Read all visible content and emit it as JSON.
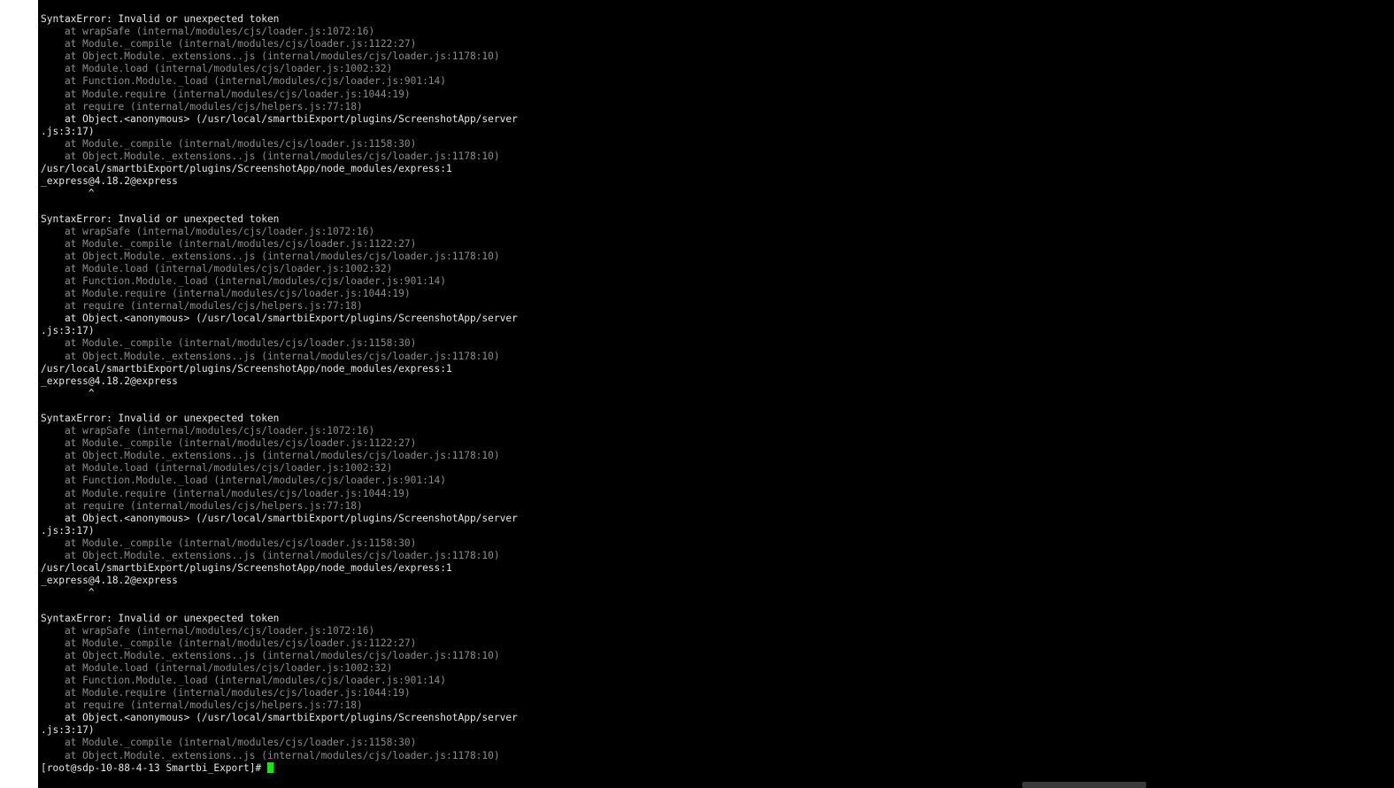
{
  "terminal": {
    "cursor_color": "#19e619",
    "lines": [
      {
        "t": "SyntaxError: Invalid or unexpected token",
        "c": "hl"
      },
      {
        "t": "    at wrapSafe (internal/modules/cjs/loader.js:1072:16)",
        "c": "dim"
      },
      {
        "t": "    at Module._compile (internal/modules/cjs/loader.js:1122:27)",
        "c": "dim"
      },
      {
        "t": "    at Object.Module._extensions..js (internal/modules/cjs/loader.js:1178:10)",
        "c": "dim"
      },
      {
        "t": "    at Module.load (internal/modules/cjs/loader.js:1002:32)",
        "c": "dim"
      },
      {
        "t": "    at Function.Module._load (internal/modules/cjs/loader.js:901:14)",
        "c": "dim"
      },
      {
        "t": "    at Module.require (internal/modules/cjs/loader.js:1044:19)",
        "c": "dim"
      },
      {
        "t": "    at require (internal/modules/cjs/helpers.js:77:18)",
        "c": "dim"
      },
      {
        "t": "    at Object.<anonymous> (/usr/local/smartbiExport/plugins/ScreenshotApp/server",
        "c": "hl"
      },
      {
        "t": ".js:3:17)",
        "c": "hl"
      },
      {
        "t": "    at Module._compile (internal/modules/cjs/loader.js:1158:30)",
        "c": "dim"
      },
      {
        "t": "    at Object.Module._extensions..js (internal/modules/cjs/loader.js:1178:10)",
        "c": "dim"
      },
      {
        "t": "/usr/local/smartbiExport/plugins/ScreenshotApp/node_modules/express:1",
        "c": "hl"
      },
      {
        "t": "_express@4.18.2@express",
        "c": "hl"
      },
      {
        "t": "        ^",
        "c": "hl"
      },
      {
        "t": "",
        "c": "hl"
      },
      {
        "t": "SyntaxError: Invalid or unexpected token",
        "c": "hl"
      },
      {
        "t": "    at wrapSafe (internal/modules/cjs/loader.js:1072:16)",
        "c": "dim"
      },
      {
        "t": "    at Module._compile (internal/modules/cjs/loader.js:1122:27)",
        "c": "dim"
      },
      {
        "t": "    at Object.Module._extensions..js (internal/modules/cjs/loader.js:1178:10)",
        "c": "dim"
      },
      {
        "t": "    at Module.load (internal/modules/cjs/loader.js:1002:32)",
        "c": "dim"
      },
      {
        "t": "    at Function.Module._load (internal/modules/cjs/loader.js:901:14)",
        "c": "dim"
      },
      {
        "t": "    at Module.require (internal/modules/cjs/loader.js:1044:19)",
        "c": "dim"
      },
      {
        "t": "    at require (internal/modules/cjs/helpers.js:77:18)",
        "c": "dim"
      },
      {
        "t": "    at Object.<anonymous> (/usr/local/smartbiExport/plugins/ScreenshotApp/server",
        "c": "hl"
      },
      {
        "t": ".js:3:17)",
        "c": "hl"
      },
      {
        "t": "    at Module._compile (internal/modules/cjs/loader.js:1158:30)",
        "c": "dim"
      },
      {
        "t": "    at Object.Module._extensions..js (internal/modules/cjs/loader.js:1178:10)",
        "c": "dim"
      },
      {
        "t": "/usr/local/smartbiExport/plugins/ScreenshotApp/node_modules/express:1",
        "c": "hl"
      },
      {
        "t": "_express@4.18.2@express",
        "c": "hl"
      },
      {
        "t": "        ^",
        "c": "hl"
      },
      {
        "t": "",
        "c": "hl"
      },
      {
        "t": "SyntaxError: Invalid or unexpected token",
        "c": "hl"
      },
      {
        "t": "    at wrapSafe (internal/modules/cjs/loader.js:1072:16)",
        "c": "dim"
      },
      {
        "t": "    at Module._compile (internal/modules/cjs/loader.js:1122:27)",
        "c": "dim"
      },
      {
        "t": "    at Object.Module._extensions..js (internal/modules/cjs/loader.js:1178:10)",
        "c": "dim"
      },
      {
        "t": "    at Module.load (internal/modules/cjs/loader.js:1002:32)",
        "c": "dim"
      },
      {
        "t": "    at Function.Module._load (internal/modules/cjs/loader.js:901:14)",
        "c": "dim"
      },
      {
        "t": "    at Module.require (internal/modules/cjs/loader.js:1044:19)",
        "c": "dim"
      },
      {
        "t": "    at require (internal/modules/cjs/helpers.js:77:18)",
        "c": "dim"
      },
      {
        "t": "    at Object.<anonymous> (/usr/local/smartbiExport/plugins/ScreenshotApp/server",
        "c": "hl"
      },
      {
        "t": ".js:3:17)",
        "c": "hl"
      },
      {
        "t": "    at Module._compile (internal/modules/cjs/loader.js:1158:30)",
        "c": "dim"
      },
      {
        "t": "    at Object.Module._extensions..js (internal/modules/cjs/loader.js:1178:10)",
        "c": "dim"
      },
      {
        "t": "/usr/local/smartbiExport/plugins/ScreenshotApp/node_modules/express:1",
        "c": "hl"
      },
      {
        "t": "_express@4.18.2@express",
        "c": "hl"
      },
      {
        "t": "        ^",
        "c": "hl"
      },
      {
        "t": "",
        "c": "hl"
      },
      {
        "t": "SyntaxError: Invalid or unexpected token",
        "c": "hl"
      },
      {
        "t": "    at wrapSafe (internal/modules/cjs/loader.js:1072:16)",
        "c": "dim"
      },
      {
        "t": "    at Module._compile (internal/modules/cjs/loader.js:1122:27)",
        "c": "dim"
      },
      {
        "t": "    at Object.Module._extensions..js (internal/modules/cjs/loader.js:1178:10)",
        "c": "dim"
      },
      {
        "t": "    at Module.load (internal/modules/cjs/loader.js:1002:32)",
        "c": "dim"
      },
      {
        "t": "    at Function.Module._load (internal/modules/cjs/loader.js:901:14)",
        "c": "dim"
      },
      {
        "t": "    at Module.require (internal/modules/cjs/loader.js:1044:19)",
        "c": "dim"
      },
      {
        "t": "    at require (internal/modules/cjs/helpers.js:77:18)",
        "c": "dim"
      },
      {
        "t": "    at Object.<anonymous> (/usr/local/smartbiExport/plugins/ScreenshotApp/server",
        "c": "hl"
      },
      {
        "t": ".js:3:17)",
        "c": "hl"
      },
      {
        "t": "    at Module._compile (internal/modules/cjs/loader.js:1158:30)",
        "c": "dim"
      },
      {
        "t": "    at Object.Module._extensions..js (internal/modules/cjs/loader.js:1178:10)",
        "c": "dim"
      }
    ],
    "prompt": "[root@sdp-10-88-4-13 Smartbi_Export]# "
  }
}
